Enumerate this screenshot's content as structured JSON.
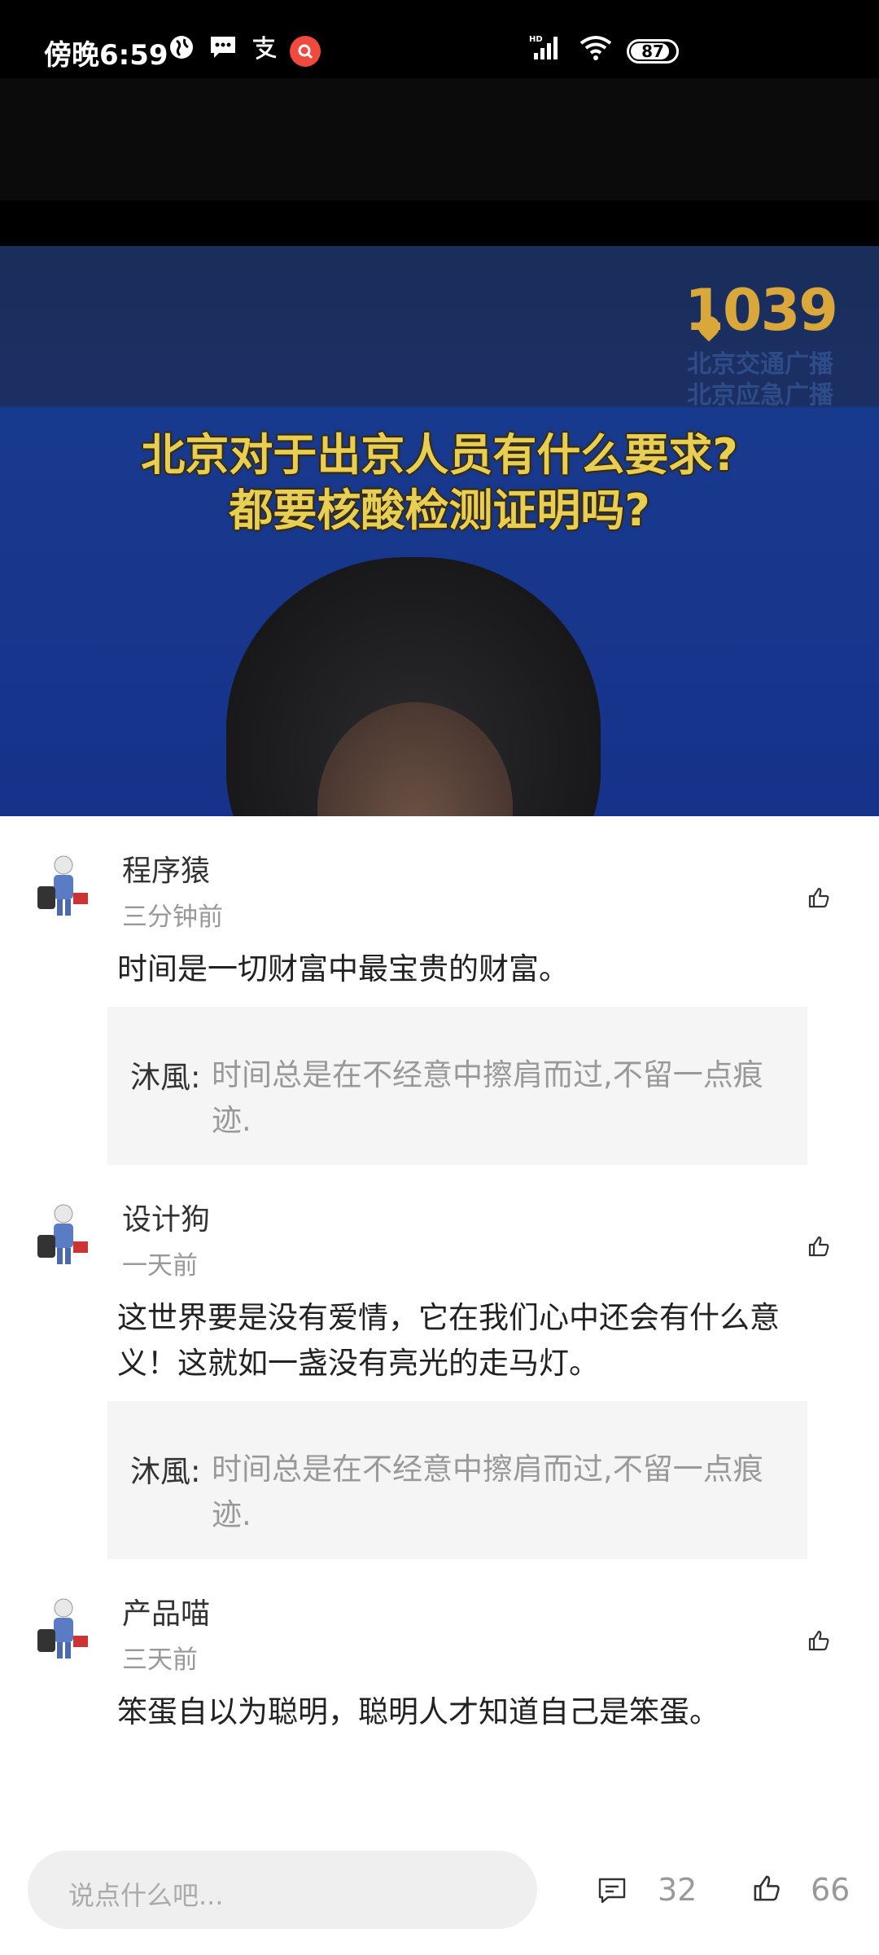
{
  "status_bar": {
    "time": "傍晚6:59",
    "battery_level": "87",
    "icons": [
      "browser-globe-icon",
      "message-icon",
      "alipay-icon",
      "notification-badge-icon",
      "hd-signal-icon",
      "wifi-icon",
      "battery-icon"
    ]
  },
  "video": {
    "logo_number": "1039",
    "logo_line1": "北京交通广播",
    "logo_line2": "北京应急广播",
    "headline_line1": "北京对于出京人员有什么要求?",
    "headline_line2": "都要核酸检测证明吗?"
  },
  "comments": [
    {
      "author": "程序猿",
      "time": "三分钟前",
      "text": "时间是一切财富中最宝贵的财富。",
      "reply": {
        "author": "沐風:",
        "text": "时间总是在不经意中擦肩而过,不留一点痕迹."
      }
    },
    {
      "author": "设计狗",
      "time": "一天前",
      "text": "这世界要是没有爱情，它在我们心中还会有什么意义！这就如一盏没有亮光的走马灯。",
      "reply": {
        "author": "沐風:",
        "text": "时间总是在不经意中擦肩而过,不留一点痕迹."
      }
    },
    {
      "author": "产品喵",
      "time": "三天前",
      "text": "笨蛋自以为聪明，聪明人才知道自己是笨蛋。"
    }
  ],
  "bottom_bar": {
    "input_placeholder": "说点什么吧...",
    "comment_count": "32",
    "like_count": "66"
  },
  "colors": {
    "video_blue": "#16328a",
    "headline_yellow": "#e7cf55",
    "logo_gold": "#d9a73a",
    "reply_bg": "#f5f5f5",
    "muted_text": "#999999"
  }
}
